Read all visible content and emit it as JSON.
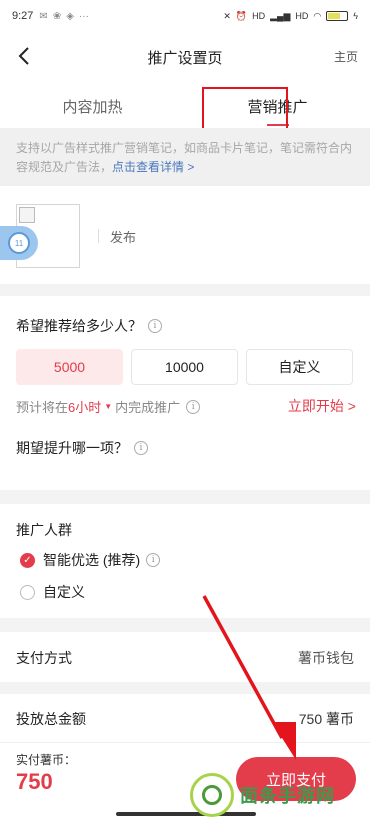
{
  "status_bar": {
    "time": "9:27",
    "dots": "···",
    "network_labels": [
      "HD",
      "HD"
    ],
    "battery": "46"
  },
  "nav": {
    "title": "推广设置页",
    "home": "主页"
  },
  "tabs": [
    {
      "label": "内容加热",
      "active": false
    },
    {
      "label": "营销推广",
      "active": true
    }
  ],
  "notice": {
    "text": "支持以广告样式推广营销笔记，如商品卡片笔记，笔记需符合内容规范及广告法，",
    "link": "点击查看详情 >"
  },
  "publish": {
    "text": "发布"
  },
  "floating_ball": {
    "text": "11"
  },
  "reach": {
    "question": "希望推荐给多少人？",
    "options": [
      {
        "label": "5000",
        "selected": true
      },
      {
        "label": "10000",
        "selected": false
      },
      {
        "label": "自定义",
        "selected": false
      }
    ],
    "estimate_prefix": "预计将在",
    "estimate_hours": "6小时",
    "estimate_suffix": "内完成推广",
    "start_now": "立即开始 >"
  },
  "goal": {
    "question": "期望提升哪一项？"
  },
  "audience": {
    "title": "推广人群",
    "options": [
      {
        "label": "智能优选 (推荐)",
        "checked": true
      },
      {
        "label": "自定义",
        "checked": false
      }
    ]
  },
  "payment": {
    "label": "支付方式",
    "value": "薯币钱包"
  },
  "total": {
    "label": "投放总金额",
    "value": "750 薯币"
  },
  "footer": {
    "pay_label": "实付薯币：",
    "pay_amount": "750",
    "pay_button": "立即支付"
  },
  "watermark": {
    "text": "面条手游网"
  },
  "colors": {
    "accent": "#e33c4b",
    "highlight_box": "#e3141c",
    "link": "#4a77bd",
    "watermark_green": "#3d9a4c"
  }
}
